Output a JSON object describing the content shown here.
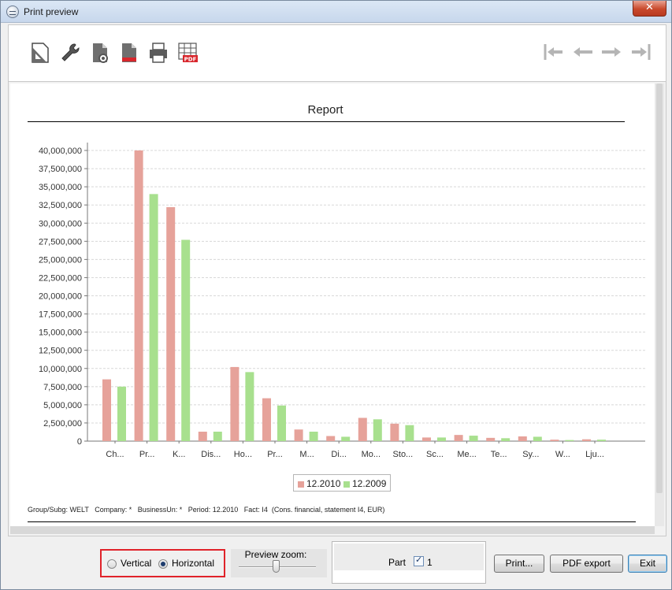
{
  "window": {
    "title": "Print preview",
    "close_label": "✕"
  },
  "toolbar": {
    "buttons": [
      {
        "icon": "page-setup-icon"
      },
      {
        "icon": "wrench-icon"
      },
      {
        "icon": "page-settings-icon"
      },
      {
        "icon": "page-remove-icon"
      },
      {
        "icon": "printer-icon"
      },
      {
        "icon": "pdf-export-icon",
        "badge": "PDF"
      }
    ],
    "navigation": [
      {
        "icon": "first-page-icon"
      },
      {
        "icon": "previous-page-icon"
      },
      {
        "icon": "next-page-icon"
      },
      {
        "icon": "last-page-icon"
      }
    ]
  },
  "report": {
    "title": "Report",
    "footer": "Group/Subg: WELT   Company: *   BusinessUn: *   Period: 12.2010   Fact: I4  (Cons. financial, statement I4, EUR)"
  },
  "chart_data": {
    "type": "bar",
    "title": "Report",
    "xlabel": "",
    "ylabel": "",
    "ylim": [
      0,
      40000000
    ],
    "yticks": [
      0,
      2500000,
      5000000,
      7500000,
      10000000,
      12500000,
      15000000,
      17500000,
      20000000,
      22500000,
      25000000,
      27500000,
      30000000,
      32500000,
      35000000,
      37500000,
      40000000
    ],
    "ytick_labels": [
      "0",
      "2,500,000",
      "5,000,000",
      "7,500,000",
      "10,000,000",
      "12,500,000",
      "15,000,000",
      "17,500,000",
      "20,000,000",
      "22,500,000",
      "25,000,000",
      "27,500,000",
      "30,000,000",
      "32,500,000",
      "35,000,000",
      "37,500,000",
      "40,000,000"
    ],
    "categories": [
      "Ch...",
      "Pr...",
      "K...",
      "Dis...",
      "Ho...",
      "Pr...",
      "M...",
      "Di...",
      "Mo...",
      "Sto...",
      "Sc...",
      "Me...",
      "Te...",
      "Sy...",
      "W...",
      "Lju..."
    ],
    "series": [
      {
        "name": "12.2010",
        "color": "#e6a29a",
        "values": [
          8500000,
          40000000,
          32200000,
          1300000,
          10200000,
          5900000,
          1600000,
          700000,
          3200000,
          2400000,
          500000,
          850000,
          450000,
          650000,
          200000,
          250000
        ]
      },
      {
        "name": "12.2009",
        "color": "#a8e08e",
        "values": [
          7500000,
          34000000,
          27700000,
          1300000,
          9500000,
          4900000,
          1300000,
          600000,
          3000000,
          2200000,
          500000,
          750000,
          400000,
          600000,
          150000,
          200000
        ]
      }
    ],
    "grid": true,
    "legend_position": "bottom"
  },
  "controls": {
    "orientation": {
      "vertical_label": "Vertical",
      "horizontal_label": "Horizontal",
      "selected": "Horizontal"
    },
    "zoom": {
      "label": "Preview zoom:",
      "value": 0.5
    },
    "part": {
      "label": "Part",
      "checked": true,
      "value": "1"
    },
    "buttons": {
      "print": "Print...",
      "pdf_export": "PDF export",
      "exit": "Exit"
    }
  }
}
